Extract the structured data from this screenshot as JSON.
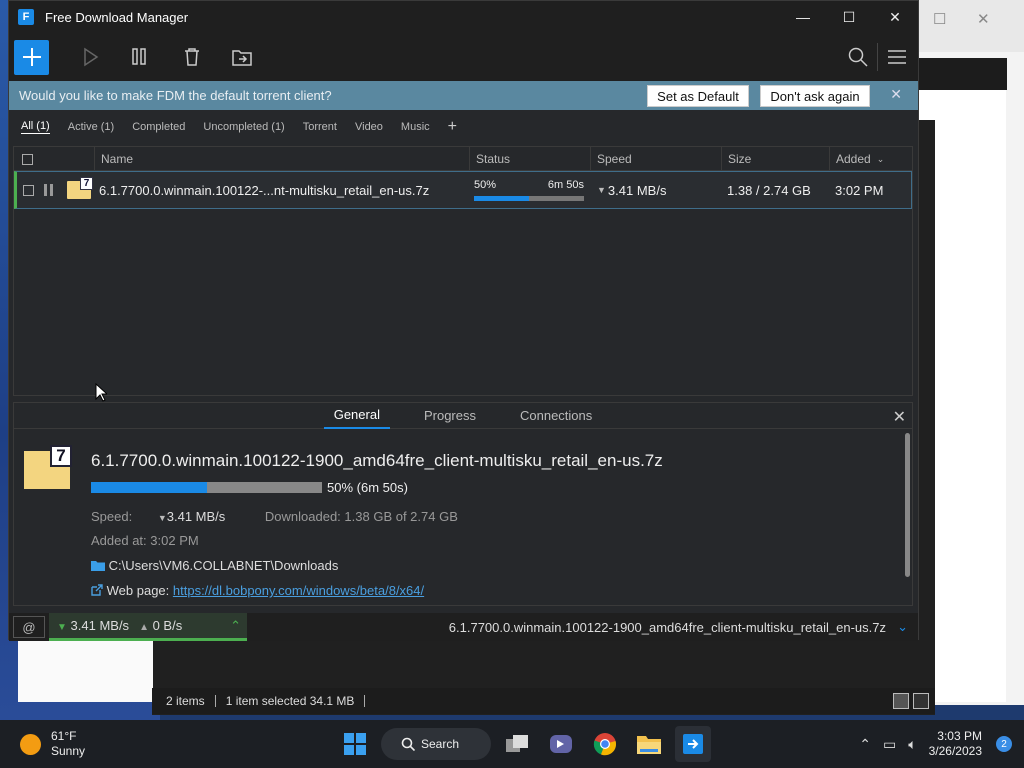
{
  "app": {
    "title": "Free Download Manager",
    "icon_letter": "F"
  },
  "window_buttons": {
    "minimize": "—",
    "maximize": "☐",
    "close": "✕"
  },
  "banner": {
    "text": "Would you like to make FDM the default torrent client?",
    "set_default": "Set as Default",
    "dont_ask": "Don't ask again",
    "close": "✕"
  },
  "filters": [
    "All (1)",
    "Active (1)",
    "Completed",
    "Uncompleted (1)",
    "Torrent",
    "Video",
    "Music"
  ],
  "filter_add": "+",
  "list": {
    "headers": {
      "name": "Name",
      "status": "Status",
      "speed": "Speed",
      "size": "Size",
      "added": "Added"
    },
    "rows": [
      {
        "name": "6.1.7700.0.winmain.100122-...nt-multisku_retail_en-us.7z",
        "progress_label": "50%",
        "progress_value": 50,
        "time_left": "6m 50s",
        "speed": "3.41 MB/s",
        "size": "1.38 / 2.74 GB",
        "added": "3:02 PM"
      }
    ]
  },
  "details": {
    "tabs": [
      "General",
      "Progress",
      "Connections"
    ],
    "close": "✕",
    "file_name": "6.1.7700.0.winmain.100122-1900_amd64fre_client-multisku_retail_en-us.7z",
    "progress_value": 50,
    "progress_text": "50% (6m 50s)",
    "speed_label": "Speed:",
    "speed_value": "3.41 MB/s",
    "downloaded_label": "Downloaded:",
    "downloaded_value": "1.38 GB of 2.74 GB",
    "added_label": "Added at:",
    "added_value": "3:02 PM",
    "path": "C:\\Users\\VM6.COLLABNET\\Downloads",
    "web_label": "Web page:",
    "web_url": "https://dl.bobpony.com/windows/beta/8/x64/"
  },
  "statusbar": {
    "down_speed": "3.41 MB/s",
    "up_speed": "0 B/s",
    "current_file": "6.1.7700.0.winmain.100122-1900_amd64fre_client-multisku_retail_en-us.7z"
  },
  "explorer_status": {
    "items": "2 items",
    "selected": "1 item selected  34.1 MB"
  },
  "taskbar": {
    "weather_temp": "61°F",
    "weather_desc": "Sunny",
    "search_label": "Search",
    "time": "3:03 PM",
    "date": "3/26/2023",
    "notification_count": "2"
  },
  "colors": {
    "accent": "#1a8ae6",
    "active_green": "#4caf50",
    "banner_bg": "#5a88a0"
  }
}
